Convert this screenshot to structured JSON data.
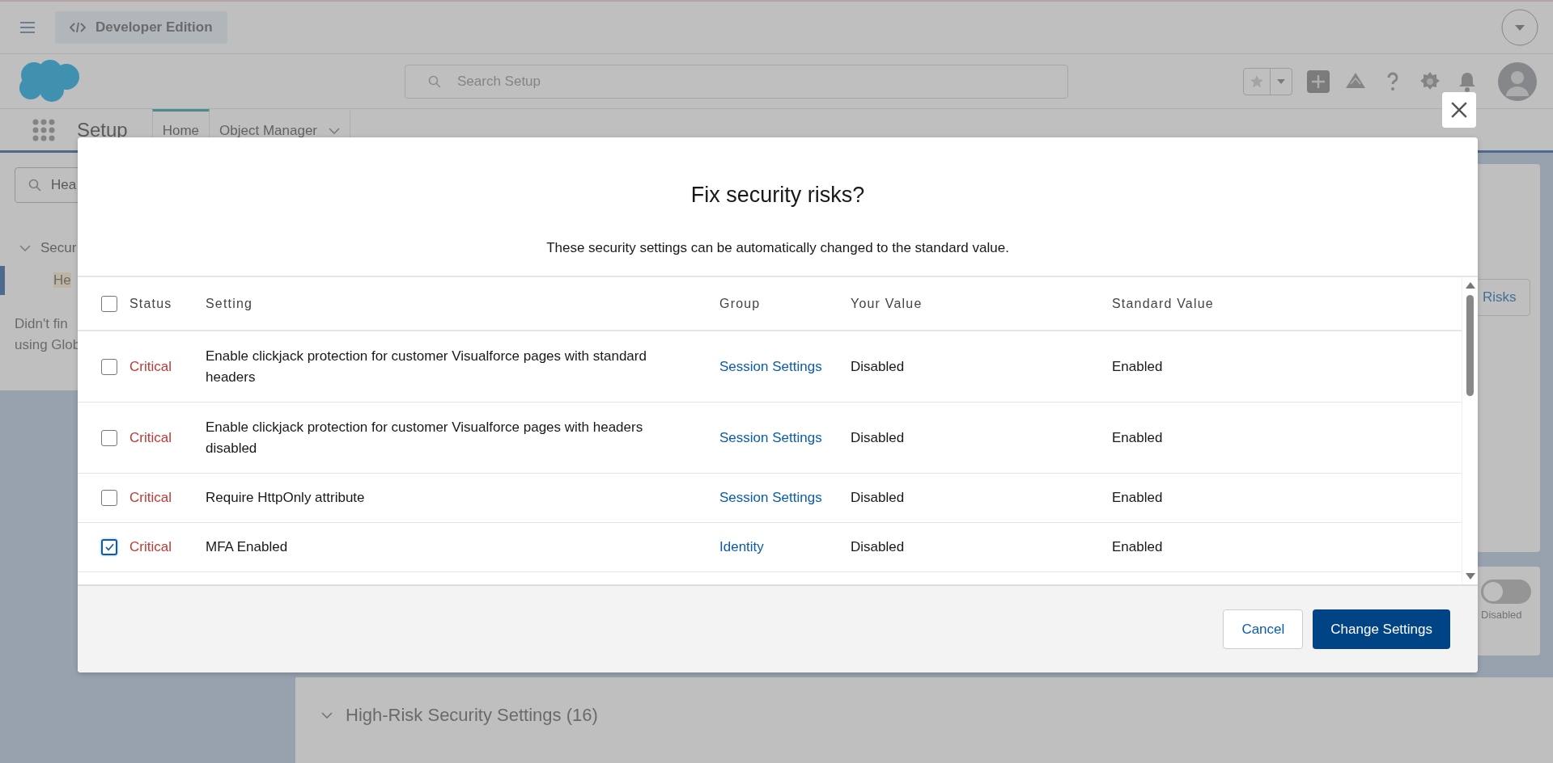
{
  "top_bar": {
    "app_badge": "Developer Edition"
  },
  "header": {
    "search": {
      "placeholder": "Search Setup"
    }
  },
  "nav": {
    "app_name": "Setup",
    "tabs": [
      {
        "label": "Home",
        "selected": true
      },
      {
        "label": "Object Manager",
        "selected": false
      }
    ]
  },
  "sidebar": {
    "search": {
      "value": "Hea"
    },
    "tree": [
      {
        "label": "Secur",
        "expanded": true,
        "children": [
          {
            "label": "He",
            "selected": true
          }
        ]
      }
    ],
    "help_lines": [
      "Didn't fin",
      "using Glob"
    ]
  },
  "main": {
    "risks_button": "Risks",
    "toggle": {
      "on": false,
      "label": "Disabled"
    },
    "section": {
      "title": "High-Risk Security Settings (16)",
      "expanded": true
    }
  },
  "dialog": {
    "title": "Fix security risks?",
    "subtitle": "These security settings can be automatically changed to the standard value.",
    "select_all": {
      "checked": false
    },
    "columns": [
      "Status",
      "Setting",
      "Group",
      "Your Value",
      "Standard Value"
    ],
    "rows": [
      {
        "checked": false,
        "status": "Critical",
        "setting": "Enable clickjack protection for customer Visualforce pages with standard headers",
        "group": "Session Settings",
        "your_value": "Disabled",
        "standard_value": "Enabled"
      },
      {
        "checked": false,
        "status": "Critical",
        "setting": "Enable clickjack protection for customer Visualforce pages with headers disabled",
        "group": "Session Settings",
        "your_value": "Disabled",
        "standard_value": "Enabled"
      },
      {
        "checked": false,
        "status": "Critical",
        "setting": "Require HttpOnly attribute",
        "group": "Session Settings",
        "your_value": "Disabled",
        "standard_value": "Enabled"
      },
      {
        "checked": true,
        "status": "Critical",
        "setting": "MFA Enabled",
        "group": "Identity",
        "your_value": "Disabled",
        "standard_value": "Enabled"
      }
    ],
    "buttons": {
      "cancel": "Cancel",
      "confirm": "Change Settings"
    }
  }
}
